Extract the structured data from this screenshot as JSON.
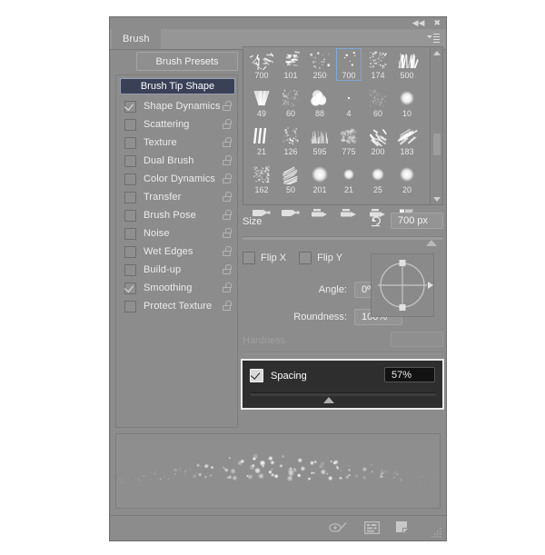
{
  "window": {
    "title": "Brush",
    "collapse_icon": "collapse-double-arrow-icon",
    "close_icon": "close-icon",
    "menu_icon": "panel-menu-icon"
  },
  "toolbar": {
    "brush_presets_label": "Brush Presets"
  },
  "options_list": {
    "selected_label": "Brush Tip Shape",
    "items": [
      {
        "label": "Shape Dynamics",
        "checked": true,
        "locked": true
      },
      {
        "label": "Scattering",
        "checked": false,
        "locked": true
      },
      {
        "label": "Texture",
        "checked": false,
        "locked": true
      },
      {
        "label": "Dual Brush",
        "checked": false,
        "locked": true
      },
      {
        "label": "Color Dynamics",
        "checked": false,
        "locked": true
      },
      {
        "label": "Transfer",
        "checked": false,
        "locked": true
      },
      {
        "label": "Brush Pose",
        "checked": false,
        "locked": true
      },
      {
        "label": "Noise",
        "checked": false,
        "locked": true
      },
      {
        "label": "Wet Edges",
        "checked": false,
        "locked": true
      },
      {
        "label": "Build-up",
        "checked": false,
        "locked": true
      },
      {
        "label": "Smoothing",
        "checked": true,
        "locked": true
      },
      {
        "label": "Protect Texture",
        "checked": false,
        "locked": true
      }
    ]
  },
  "brush_grid": {
    "selected_index": 3,
    "tips": [
      {
        "size": "700",
        "style": "scratch"
      },
      {
        "size": "101",
        "style": "smudge"
      },
      {
        "size": "250",
        "style": "spatter"
      },
      {
        "size": "700",
        "style": "sparse-dots"
      },
      {
        "size": "174",
        "style": "chalk"
      },
      {
        "size": "500",
        "style": "grass"
      },
      {
        "size": "49",
        "style": "fan"
      },
      {
        "size": "60",
        "style": "noise-square"
      },
      {
        "size": "88",
        "style": "cloud"
      },
      {
        "size": "4",
        "style": "tiny-dot"
      },
      {
        "size": "60",
        "style": "faint-noise"
      },
      {
        "size": "10",
        "style": "soft-round"
      },
      {
        "size": "21",
        "style": "stripes"
      },
      {
        "size": "126",
        "style": "speckle"
      },
      {
        "size": "595",
        "style": "fine-grass"
      },
      {
        "size": "775",
        "style": "soft-speckle"
      },
      {
        "size": "200",
        "style": "flick"
      },
      {
        "size": "183",
        "style": "hatch"
      },
      {
        "size": "162",
        "style": "dense-noise"
      },
      {
        "size": "50",
        "style": "stroke-hatch"
      },
      {
        "size": "201",
        "style": "soft-round"
      },
      {
        "size": "21",
        "style": "soft-round"
      },
      {
        "size": "25",
        "style": "soft-round"
      },
      {
        "size": "20",
        "style": "soft-round"
      }
    ],
    "tool_icons": [
      "brush-tip-flat-icon",
      "brush-tip-flat-icon",
      "brush-tip-pointed-icon",
      "brush-tip-pointed-icon",
      "brush-tip-pointed-icon",
      "brush-tip-chisel-icon"
    ],
    "scroll_up_icon": "scroll-up-arrow-icon",
    "scroll_down_icon": "scroll-down-arrow-icon"
  },
  "size": {
    "label": "Size",
    "value": "700 px",
    "reset_icon": "reset-arrow-icon",
    "slider_percent": 94
  },
  "flip": {
    "x_label": "Flip X",
    "y_label": "Flip Y",
    "x_checked": false,
    "y_checked": false
  },
  "angle": {
    "label": "Angle:",
    "value": "0º"
  },
  "roundness": {
    "label": "Roundness:",
    "value": "100%"
  },
  "hardness": {
    "label": "Hardness",
    "value": ""
  },
  "spacing": {
    "label": "Spacing",
    "value": "57%",
    "checked": true,
    "slider_percent": 42
  },
  "preview": {
    "name": "brush-stroke-preview"
  },
  "bottom_bar": {
    "icons": [
      "toggle-brush-pressure-icon",
      "create-new-preset-icon",
      "new-brush-icon"
    ],
    "grip_icon": "resize-grip-icon"
  }
}
